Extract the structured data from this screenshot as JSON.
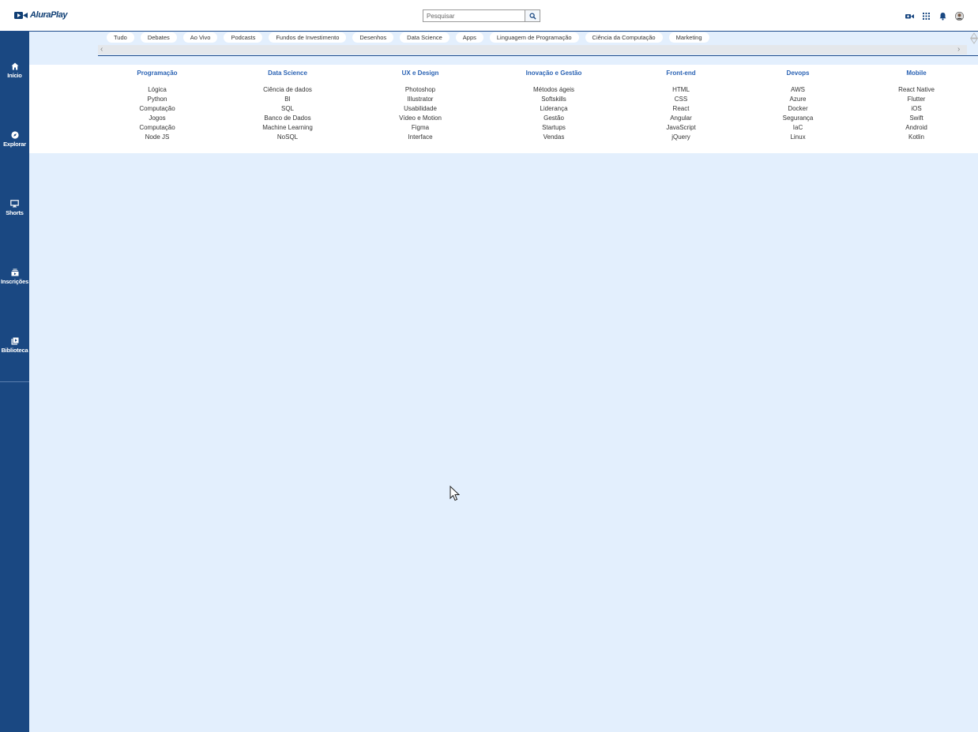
{
  "header": {
    "logo_text": "AluraPlay",
    "search_placeholder": "Pesquisar",
    "icons": [
      "video-camera-icon",
      "apps-grid-icon",
      "bell-icon",
      "user-avatar-icon"
    ]
  },
  "sidebar": {
    "items": [
      {
        "label": "Início",
        "icon": "home-icon"
      },
      {
        "label": "Explorar",
        "icon": "compass-icon"
      },
      {
        "label": "Shorts",
        "icon": "monitor-icon"
      },
      {
        "label": "Inscrições",
        "icon": "subscriptions-icon"
      },
      {
        "label": "Biblioteca",
        "icon": "library-icon"
      }
    ]
  },
  "chips": [
    "Tudo",
    "Debates",
    "Ao Vivo",
    "Podcasts",
    "Fundos de Investimento",
    "Desenhos",
    "Data Science",
    "Apps",
    "Linguagem de Programação",
    "Ciência da Computação",
    "Marketing"
  ],
  "menu": {
    "columns": [
      {
        "title": "Programação",
        "links": [
          "Lógica",
          "Python",
          "Computação",
          "Jogos",
          "Computação",
          "Node JS"
        ]
      },
      {
        "title": "Data Science",
        "links": [
          "Ciência de dados",
          "BI",
          "SQL",
          "Banco de Dados",
          "Machine Learning",
          "NoSQL"
        ]
      },
      {
        "title": "UX e Design",
        "links": [
          "Photoshop",
          "Illustrator",
          "Usabilidade",
          "Vídeo e Motion",
          "Figma",
          "Interface"
        ]
      },
      {
        "title": "Inovação e Gestão",
        "links": [
          "Métodos ágeis",
          "Softskills",
          "Liderança",
          "Gestão",
          "Startups",
          "Vendas"
        ]
      },
      {
        "title": "Front-end",
        "links": [
          "HTML",
          "CSS",
          "React",
          "Angular",
          "JavaScript",
          "jQuery"
        ]
      },
      {
        "title": "Devops",
        "links": [
          "AWS",
          "Azure",
          "Docker",
          "Segurança",
          "IaC",
          "Linux"
        ]
      },
      {
        "title": "Mobile",
        "links": [
          "React Native",
          "Flutter",
          "iOS",
          "Swift",
          "Android",
          "Kotlin"
        ]
      }
    ]
  },
  "colors": {
    "sidebar_bg": "#1a4882",
    "page_bg": "#e3effd",
    "menu_title": "#2b63b4"
  }
}
